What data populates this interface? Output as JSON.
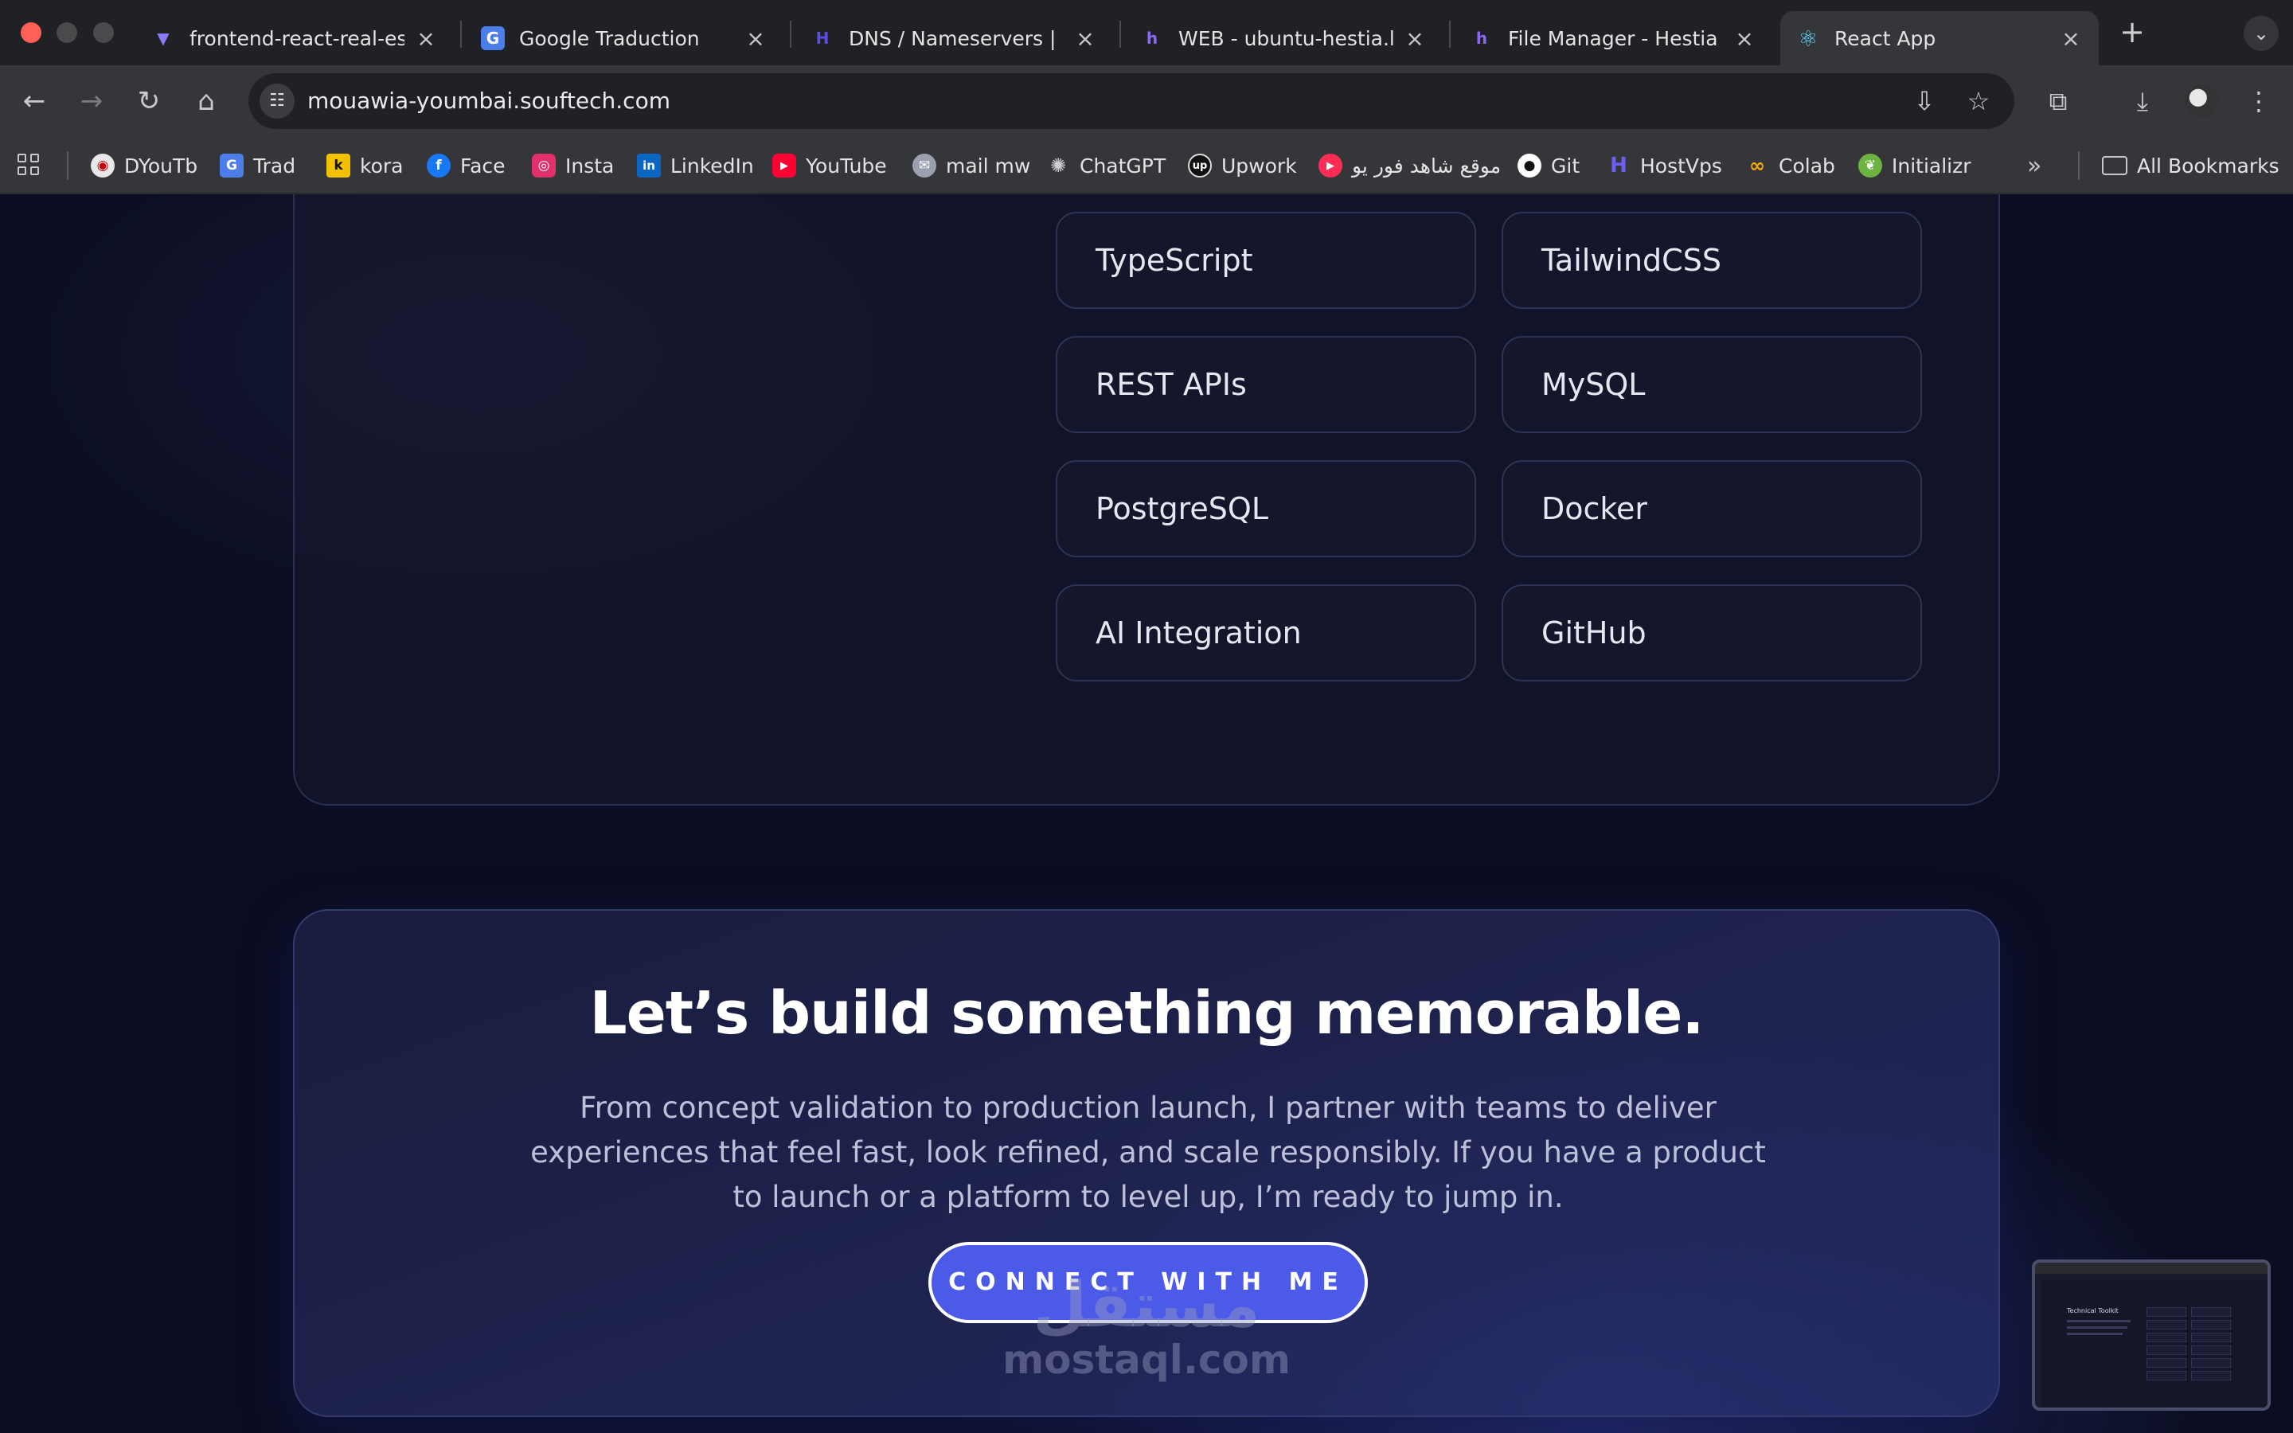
{
  "browser": {
    "tabs": [
      {
        "title": "frontend-react-real-estate",
        "icon": "vite-icon",
        "color": "#8b7cff"
      },
      {
        "title": "Google Traduction",
        "icon": "google-translate-icon",
        "color": "#4c7de8"
      },
      {
        "title": "DNS / Nameservers | Hostinger",
        "icon": "hostinger-icon",
        "color": "#5a4fe0"
      },
      {
        "title": "WEB - ubuntu-hestia.local",
        "icon": "hestia-icon",
        "color": "#7a62e0"
      },
      {
        "title": "File Manager - Hestia Control Panel",
        "icon": "hestia-icon",
        "color": "#7a62e0"
      },
      {
        "title": "React App",
        "icon": "react-icon",
        "color": "#61dafb",
        "active": true
      }
    ],
    "url": "mouawia-youmbai.souftech.com",
    "bookmarks": [
      {
        "label": "DYouTb",
        "icon": "dyoutb-icon",
        "color": "#e8e8e8"
      },
      {
        "label": "Trad",
        "icon": "translate-icon",
        "color": "#4c7de8"
      },
      {
        "label": "kora",
        "icon": "kora-icon",
        "color": "#f2c200"
      },
      {
        "label": "Face",
        "icon": "facebook-icon",
        "color": "#1877f2"
      },
      {
        "label": "Insta",
        "icon": "instagram-icon",
        "color": "#e1306c"
      },
      {
        "label": "LinkedIn",
        "icon": "linkedin-icon",
        "color": "#0a66c2"
      },
      {
        "label": "YouTube",
        "icon": "youtube-icon",
        "color": "#ff0033"
      },
      {
        "label": "mail mw",
        "icon": "mail-icon",
        "color": "#9aa0b0"
      },
      {
        "label": "ChatGPT",
        "icon": "chatgpt-icon",
        "color": "#d0d0d0"
      },
      {
        "label": "Upwork",
        "icon": "upwork-icon",
        "color": "#111111"
      },
      {
        "label": "موقع شاهد فور يو",
        "icon": "shahid-icon",
        "color": "#ff2d55"
      },
      {
        "label": "Git",
        "icon": "github-icon",
        "color": "#ffffff"
      },
      {
        "label": "HostVps",
        "icon": "hostinger-icon",
        "color": "#5a4fe0"
      },
      {
        "label": "Colab",
        "icon": "colab-icon",
        "color": "#f9ab00"
      },
      {
        "label": "Initializr",
        "icon": "spring-icon",
        "color": "#6db33f"
      }
    ],
    "all_bookmarks": "All Bookmarks"
  },
  "toolkit": {
    "skills": [
      [
        "TypeScript",
        "TailwindCSS"
      ],
      [
        "REST APIs",
        "MySQL"
      ],
      [
        "PostgreSQL",
        "Docker"
      ],
      [
        "AI Integration",
        "GitHub"
      ]
    ]
  },
  "cta": {
    "title": "Let’s build something memorable.",
    "text": "From concept validation to production launch, I partner with teams to deliver experiences that feel fast, look refined, and scale responsibly. If you have a product to launch or a platform to level up, I’m ready to jump in.",
    "button": "CONNECT WITH ME"
  },
  "watermark": {
    "arabic": "مستقل",
    "latin": "mostaql.com"
  },
  "preview": {
    "title": "Technical Toolkit"
  }
}
